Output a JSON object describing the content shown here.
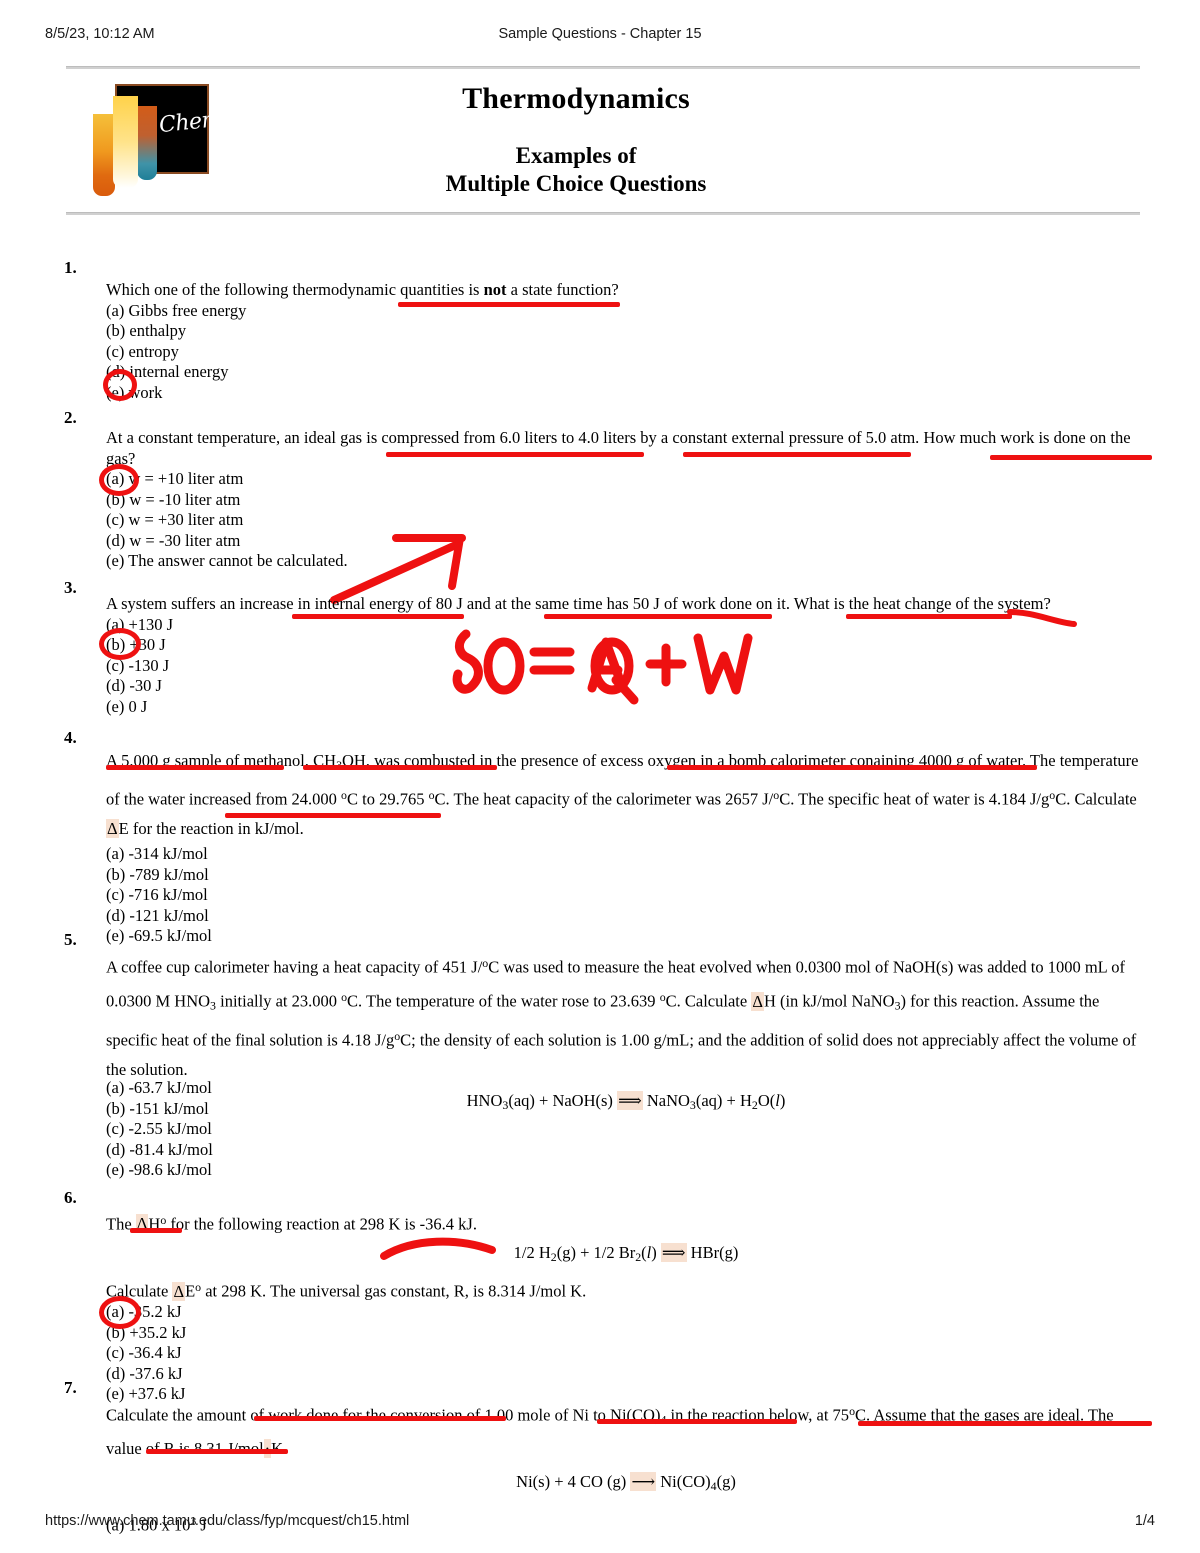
{
  "print_header": {
    "date": "8/5/23, 10:12 AM",
    "title": "Sample Questions - Chapter 15"
  },
  "print_footer": {
    "url": "https://www.chem.tamu.edu/class/fyp/mcquest/ch15.html",
    "page": "1/4"
  },
  "masthead": {
    "logo_text": "Chem",
    "title": "Thermodynamics",
    "subtitle_line1": "Examples of",
    "subtitle_line2": "Multiple Choice Questions"
  },
  "annotation_color": "#ee1111",
  "handwriting": {
    "equation": "80 = ΔQ + W"
  },
  "questions": [
    {
      "number": "1.",
      "stem": "Which one of the following thermodynamic quantities is not a state function?",
      "stem_bold_word": "not",
      "options": [
        "(a) Gibbs free energy",
        "(b) enthalpy",
        "(c) entropy",
        "(d) internal energy",
        "(e) work"
      ],
      "circled_option": "(e)"
    },
    {
      "number": "2.",
      "stem": "At a constant temperature, an ideal gas is compressed from 6.0 liters to 4.0 liters by a constant external pressure of 5.0 atm. How much work is done on the gas?",
      "options": [
        "(a) w = +10 liter atm",
        "(b) w = -10 liter atm",
        "(c) w = +30 liter atm",
        "(d) w = -30 liter atm",
        "(e) The answer cannot be calculated."
      ],
      "circled_option": "(a)"
    },
    {
      "number": "3.",
      "stem": "A system suffers an increase in internal energy of 80 J and at the same time has 50 J of work done on it. What is the heat change of the system?",
      "options": [
        "(a) +130 J",
        "(b) +30 J",
        "(c) -130 J",
        "(d) -30 J",
        "(e) 0 J"
      ],
      "circled_option": "(b)"
    },
    {
      "number": "4.",
      "stem_part1": "A 5.000 g sample of methanol, CH",
      "stem_part1b": "OH, was combusted in the presence of excess oxygen in a bomb calorimeter conaining 4000 g of water. The temperature of the water increased from 24.000 ",
      "stem_part2": "C to 29.765 ",
      "stem_part3": "C. The heat capacity of the calorimeter was 2657 J/",
      "stem_part4": "C. The specific heat of water is 4.184 J/g",
      "stem_part5": "C. Calculate ",
      "stem_part6": "E for the reaction in kJ/mol.",
      "options": [
        "(a) -314 kJ/mol",
        "(b) -789 kJ/mol",
        "(c) -716 kJ/mol",
        "(d) -121 kJ/mol",
        "(e) -69.5 kJ/mol"
      ],
      "circled_option": null
    },
    {
      "number": "5.",
      "stem_a": "A coffee cup calorimeter having a heat capacity of 451 J/",
      "stem_b": "C was used to measure the heat evolved when 0.0300 mol of NaOH(s) was added to 1000 mL of 0.0300 M HNO",
      "stem_c": " initially at 23.000 ",
      "stem_d": "C. The temperature of the water rose to 23.639 ",
      "stem_e": "C. Calculate ",
      "stem_f": "H (in kJ/mol NaNO",
      "stem_g": ") for this reaction. Assume the specific heat of the final solution is 4.18 J/g",
      "stem_h": "C; the density of each solution is 1.00 g/mL; and the addition of solid does not appreciably affect the volume of the solution.",
      "reaction": "HNO3(aq) + NaOH(s) ⟹ NaNO3(aq) + H2O(l)",
      "options": [
        "(a) -63.7 kJ/mol",
        "(b) -151 kJ/mol",
        "(c) -2.55 kJ/mol",
        "(d) -81.4 kJ/mol",
        "(e) -98.6 kJ/mol"
      ],
      "circled_option": null
    },
    {
      "number": "6.",
      "stem_a": "The ",
      "stem_b": "H",
      "stem_c": " for the following reaction at 298 K is -36.4 kJ.",
      "reaction": "1/2 H2(g) + 1/2 Br2(l) ⟹ HBr(g)",
      "stem_d": "Calculate ",
      "stem_e": "E",
      "stem_f": " at 298 K. The universal gas constant, R, is 8.314 J/mol K.",
      "options": [
        "(a) -35.2 kJ",
        "(b) +35.2 kJ",
        "(c) -36.4 kJ",
        "(d) -37.6 kJ",
        "(e) +37.6 kJ"
      ],
      "circled_option": "(c)"
    },
    {
      "number": "7.",
      "stem_a": "Calculate the amount of work done for the conversion of 1.00 mole of Ni to Ni(CO)",
      "stem_b": " in the reaction below, at 75",
      "stem_c": "C. Assume that the gases are ideal. The value of R is 8.31 J/mol",
      "stem_d": "K.",
      "reaction": "Ni(s) + 4 CO (g) ⟶ Ni(CO)4(g)",
      "options": [
        "(a) 1.80 x 10^3 J"
      ],
      "option_a_mantissa": "(a) 1.80 x 10",
      "option_a_exp": "3",
      "option_a_unit": " J",
      "circled_option": null
    }
  ]
}
